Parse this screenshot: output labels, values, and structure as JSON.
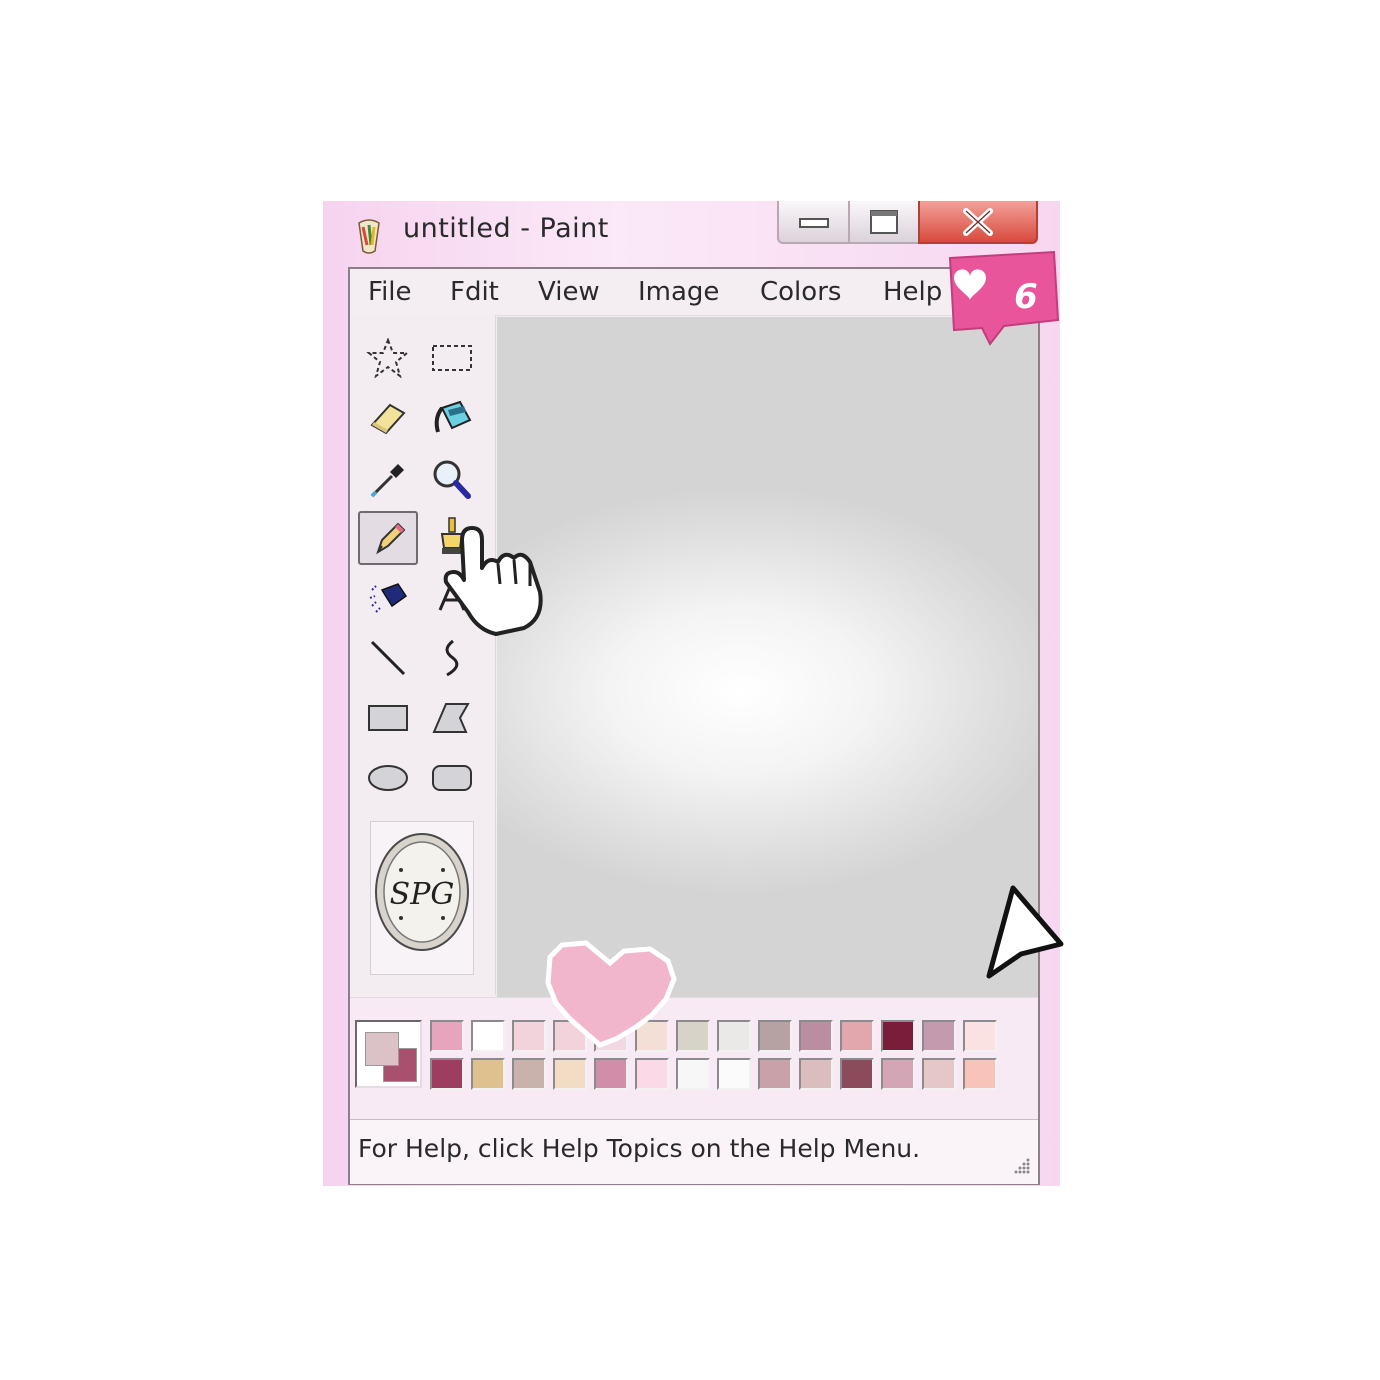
{
  "window": {
    "title": "untitled - Paint",
    "icon": "paint-app-icon",
    "controls": {
      "minimize": "minimize-icon",
      "maximize": "maximize-icon",
      "close": "close-icon"
    }
  },
  "menu": {
    "items": [
      {
        "label": "File"
      },
      {
        "label": "Fdit"
      },
      {
        "label": "View"
      },
      {
        "label": "Image"
      },
      {
        "label": "Colors"
      },
      {
        "label": "Help"
      }
    ]
  },
  "toolbox": {
    "tools": [
      {
        "icon": "free-form-select-icon"
      },
      {
        "icon": "rectangle-select-icon"
      },
      {
        "icon": "eraser-icon"
      },
      {
        "icon": "fill-bucket-icon"
      },
      {
        "icon": "color-picker-icon"
      },
      {
        "icon": "magnifier-icon"
      },
      {
        "icon": "pencil-icon",
        "selected": true
      },
      {
        "icon": "brush-icon"
      },
      {
        "icon": "airbrush-icon"
      },
      {
        "icon": "text-icon"
      },
      {
        "icon": "line-icon"
      },
      {
        "icon": "curve-icon"
      },
      {
        "icon": "rectangle-icon"
      },
      {
        "icon": "polygon-icon"
      },
      {
        "icon": "ellipse-icon"
      },
      {
        "icon": "rounded-rectangle-icon"
      }
    ],
    "stamp_letters": "SPG"
  },
  "like_badge": {
    "count": "6",
    "icon": "heart-icon"
  },
  "palette": {
    "foreground": "#dcc2c6",
    "background": "#a8506e",
    "row1": [
      "#e7a4bd",
      "#ffffff",
      "#f2d3dc",
      "#f2d3dc",
      "#f0d9e3",
      "#f4dfd6",
      "#d7d3c8",
      "#ebe8e8",
      "#b7a2a3",
      "#b98ea1",
      "#e2a6ad",
      "#7a1d3a",
      "#c49bae",
      "#fbe2e2"
    ],
    "row2": [
      "#9d3d5f",
      "#dfc08f",
      "#c9b2ab",
      "#f2dcc4",
      "#d08ea8",
      "#fbd9e6",
      "#f7f7f7",
      "#fbfbfb",
      "#c9a2a9",
      "#dbbdbd",
      "#8c4b5b",
      "#d4a6b5",
      "#e6c7c7",
      "#f8c3b8"
    ]
  },
  "status": {
    "text": "For Help, click Help Topics on the Help Menu."
  }
}
